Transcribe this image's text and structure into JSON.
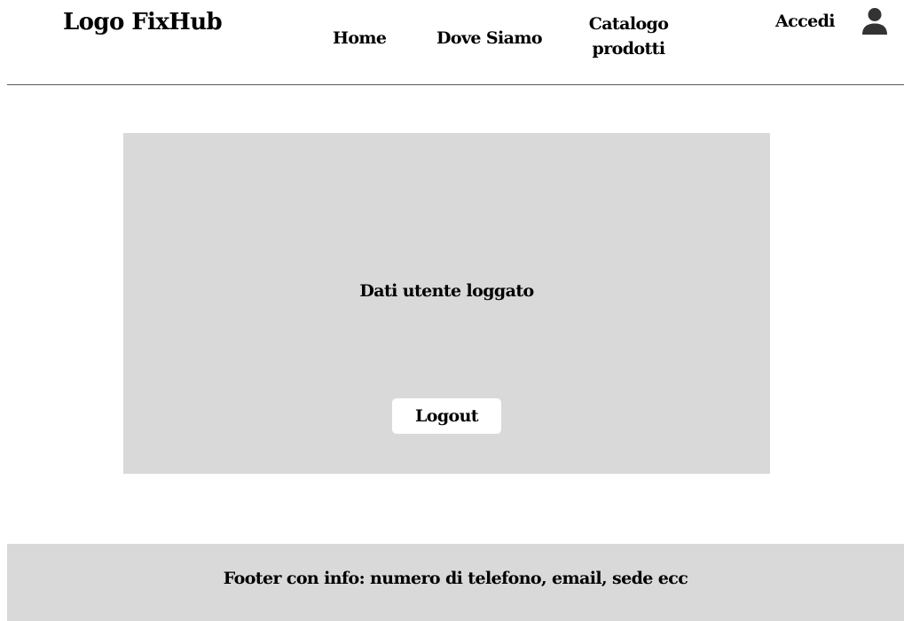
{
  "header": {
    "logo": "Logo FixHub",
    "nav": {
      "home": "Home",
      "dove_siamo": "Dove Siamo",
      "catalogo_line1": "Catalogo",
      "catalogo_line2": "prodotti"
    },
    "login_label": "Accedi",
    "user_icon": "user-icon"
  },
  "main": {
    "title": "Dati utente loggato",
    "logout_label": "Logout"
  },
  "footer": {
    "text": "Footer con info: numero di telefono, email, sede ecc"
  },
  "colors": {
    "panel_background": "#d9d9d9",
    "page_background": "#ffffff",
    "text": "#000000",
    "icon": "#333333",
    "rule": "#5a5a5a"
  }
}
